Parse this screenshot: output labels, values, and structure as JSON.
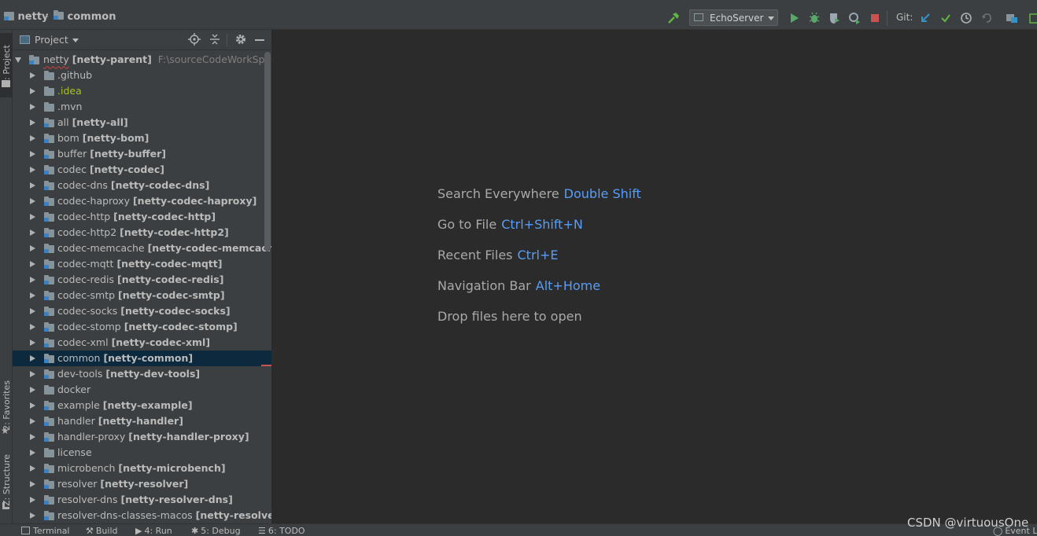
{
  "breadcrumb": {
    "project": "netty",
    "module": "common"
  },
  "toolbar": {
    "run_config": "EchoServer",
    "git_label": "Git:"
  },
  "left_stripe": {
    "project_tab": "1: Project",
    "favorites_tab": "2: Favorites",
    "structure_tab": "Z: Structure"
  },
  "panel": {
    "title": "Project"
  },
  "tree": {
    "root": {
      "name": "netty",
      "module": "[netty-parent]",
      "path": "F:\\sourceCodeWorkSpace\\ne"
    },
    "items": [
      {
        "name": ".github",
        "module": "",
        "kind": "folder"
      },
      {
        "name": ".idea",
        "module": "",
        "kind": "folder",
        "color": "#a8c023"
      },
      {
        "name": ".mvn",
        "module": "",
        "kind": "folder"
      },
      {
        "name": "all",
        "module": "[netty-all]",
        "kind": "module"
      },
      {
        "name": "bom",
        "module": "[netty-bom]",
        "kind": "module"
      },
      {
        "name": "buffer",
        "module": "[netty-buffer]",
        "kind": "module"
      },
      {
        "name": "codec",
        "module": "[netty-codec]",
        "kind": "module"
      },
      {
        "name": "codec-dns",
        "module": "[netty-codec-dns]",
        "kind": "module"
      },
      {
        "name": "codec-haproxy",
        "module": "[netty-codec-haproxy]",
        "kind": "module"
      },
      {
        "name": "codec-http",
        "module": "[netty-codec-http]",
        "kind": "module"
      },
      {
        "name": "codec-http2",
        "module": "[netty-codec-http2]",
        "kind": "module"
      },
      {
        "name": "codec-memcache",
        "module": "[netty-codec-memcache]",
        "kind": "module"
      },
      {
        "name": "codec-mqtt",
        "module": "[netty-codec-mqtt]",
        "kind": "module"
      },
      {
        "name": "codec-redis",
        "module": "[netty-codec-redis]",
        "kind": "module"
      },
      {
        "name": "codec-smtp",
        "module": "[netty-codec-smtp]",
        "kind": "module"
      },
      {
        "name": "codec-socks",
        "module": "[netty-codec-socks]",
        "kind": "module"
      },
      {
        "name": "codec-stomp",
        "module": "[netty-codec-stomp]",
        "kind": "module"
      },
      {
        "name": "codec-xml",
        "module": "[netty-codec-xml]",
        "kind": "module"
      },
      {
        "name": "common",
        "module": "[netty-common]",
        "kind": "module",
        "selected": true
      },
      {
        "name": "dev-tools",
        "module": "[netty-dev-tools]",
        "kind": "module"
      },
      {
        "name": "docker",
        "module": "",
        "kind": "folder"
      },
      {
        "name": "example",
        "module": "[netty-example]",
        "kind": "module"
      },
      {
        "name": "handler",
        "module": "[netty-handler]",
        "kind": "module"
      },
      {
        "name": "handler-proxy",
        "module": "[netty-handler-proxy]",
        "kind": "module"
      },
      {
        "name": "license",
        "module": "",
        "kind": "folder"
      },
      {
        "name": "microbench",
        "module": "[netty-microbench]",
        "kind": "module"
      },
      {
        "name": "resolver",
        "module": "[netty-resolver]",
        "kind": "module"
      },
      {
        "name": "resolver-dns",
        "module": "[netty-resolver-dns]",
        "kind": "module"
      },
      {
        "name": "resolver-dns-classes-macos",
        "module": "[netty-resolver-dn",
        "kind": "module"
      }
    ]
  },
  "editor": {
    "hints": [
      {
        "text": "Search Everywhere",
        "key": "Double Shift"
      },
      {
        "text": "Go to File",
        "key": "Ctrl+Shift+N"
      },
      {
        "text": "Recent Files",
        "key": "Ctrl+E"
      },
      {
        "text": "Navigation Bar",
        "key": "Alt+Home"
      },
      {
        "text": "Drop files here to open",
        "key": ""
      }
    ]
  },
  "bottom": {
    "terminal": "Terminal",
    "build": "Build",
    "run": "4: Run",
    "debug": "5: Debug",
    "todo": "6: TODO",
    "event_log": "Event Lo"
  },
  "watermark": "CSDN @virtuousOne",
  "colors": {
    "accent": "#589df6",
    "selection": "#0d293e",
    "panel": "#3c3f41",
    "editor": "#2b2b2b"
  }
}
